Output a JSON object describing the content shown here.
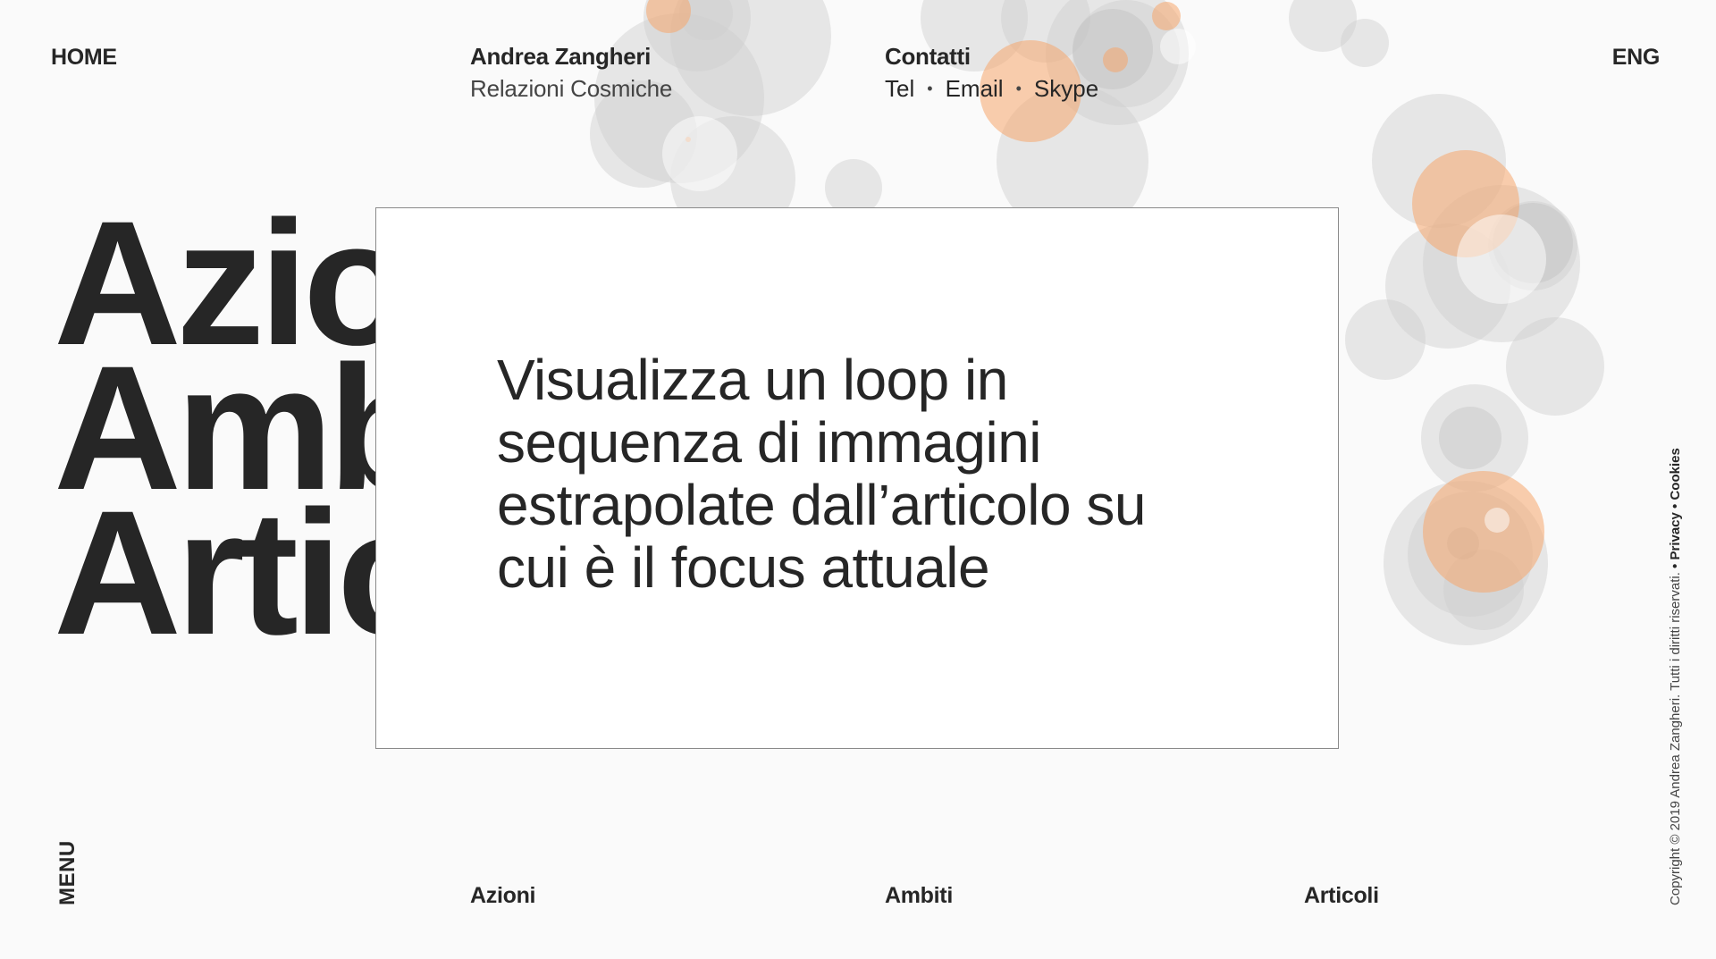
{
  "nav": {
    "home": "HOME",
    "lang": "ENG"
  },
  "brand": {
    "name": "Andrea Zangheri",
    "tagline": "Relazioni Cosmiche"
  },
  "contacts": {
    "title": "Contatti",
    "links": [
      "Tel",
      "Email",
      "Skype"
    ],
    "separator": "•"
  },
  "hero": {
    "words": [
      "Azioni",
      "Ambiti",
      "Articoli"
    ]
  },
  "overlay": {
    "text_lines": [
      "Visualizza un loop in",
      "sequenza di immagini",
      "estrapolate dall’articolo su",
      "cui è il focus attuale"
    ]
  },
  "menu": {
    "label": "MENU"
  },
  "bottom_nav": [
    "Azioni",
    "Ambiti",
    "Articoli"
  ],
  "footer": {
    "copyright": "Copyright © 2019 Andrea Zangheri. Tutti i diritti riservati.",
    "privacy": "• Privacy",
    "cookies": "• Cookies"
  },
  "colors": {
    "background": "#fafafa",
    "text": "#262626",
    "accent": "#f5a56b",
    "bubble": "#d0d0d0"
  }
}
